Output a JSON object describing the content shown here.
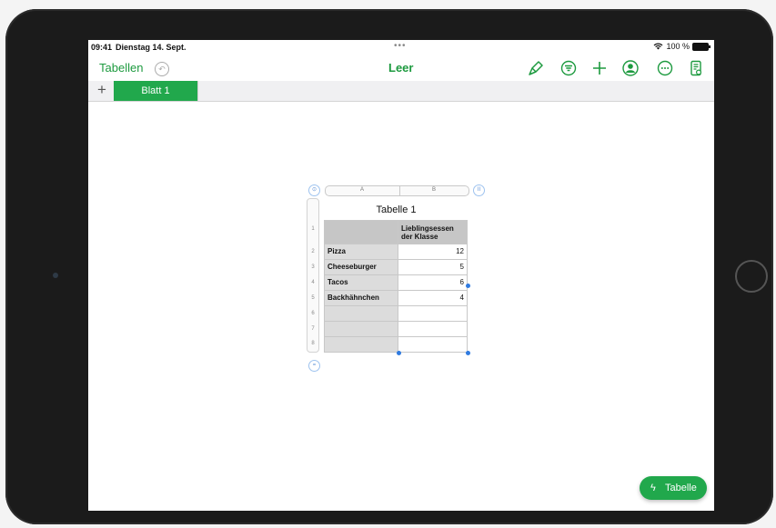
{
  "status": {
    "time": "09:41",
    "date": "Dienstag 14. Sept.",
    "dots": "•••",
    "battery": "100 %"
  },
  "toolbar": {
    "back_label": "Tabellen",
    "title": "Leer",
    "icons": [
      "undo-icon",
      "format-brush-icon",
      "filter-icon",
      "add-icon",
      "collaborate-icon",
      "more-icon",
      "document-icon"
    ]
  },
  "tabs": {
    "add_label": "+",
    "items": [
      {
        "label": "Blatt 1",
        "selected": true
      }
    ]
  },
  "table": {
    "title": "Tabelle 1",
    "col_headers": [
      "A",
      "B"
    ],
    "col_handle": "II",
    "row_numbers": [
      "1",
      "2",
      "3",
      "4",
      "5",
      "6",
      "7",
      "8"
    ],
    "header_b": "Lieblingsessen der Klasse",
    "rows": [
      {
        "a": "Pizza",
        "b": "12"
      },
      {
        "a": "Cheeseburger",
        "b": "5"
      },
      {
        "a": "Tacos",
        "b": "6"
      },
      {
        "a": "Backhähnchen",
        "b": "4"
      },
      {
        "a": "",
        "b": ""
      },
      {
        "a": "",
        "b": ""
      },
      {
        "a": "",
        "b": ""
      }
    ],
    "row_handle": "="
  },
  "fab": {
    "label": "Tabelle",
    "icon": "lightning-icon"
  },
  "colors": {
    "accent": "#21a84c",
    "selection": "#2f7be1"
  }
}
